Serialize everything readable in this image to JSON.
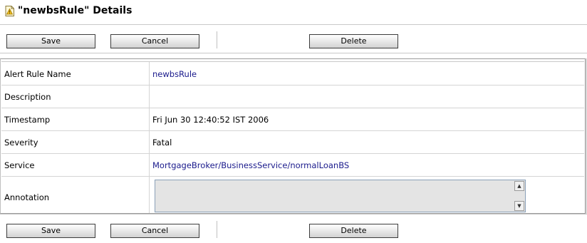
{
  "title": "\"newbsRule\" Details",
  "icon": "alert-rule-icon",
  "toolbar": {
    "save_label": "Save",
    "cancel_label": "Cancel",
    "delete_label": "Delete"
  },
  "fields": {
    "alert_rule_name": {
      "label": "Alert Rule Name",
      "value": "newbsRule"
    },
    "description": {
      "label": "Description",
      "value": ""
    },
    "timestamp": {
      "label": "Timestamp",
      "value": "Fri Jun 30 12:40:52 IST 2006"
    },
    "severity": {
      "label": "Severity",
      "value": "Fatal"
    },
    "service": {
      "label": "Service",
      "value": "MortgageBroker/BusinessService/normalLoanBS"
    },
    "annotation": {
      "label": "Annotation",
      "value": ""
    }
  },
  "colors": {
    "link": "#1a1a8c",
    "annotation_bg": "#e4e4e4",
    "border": "#c8c8c8"
  }
}
